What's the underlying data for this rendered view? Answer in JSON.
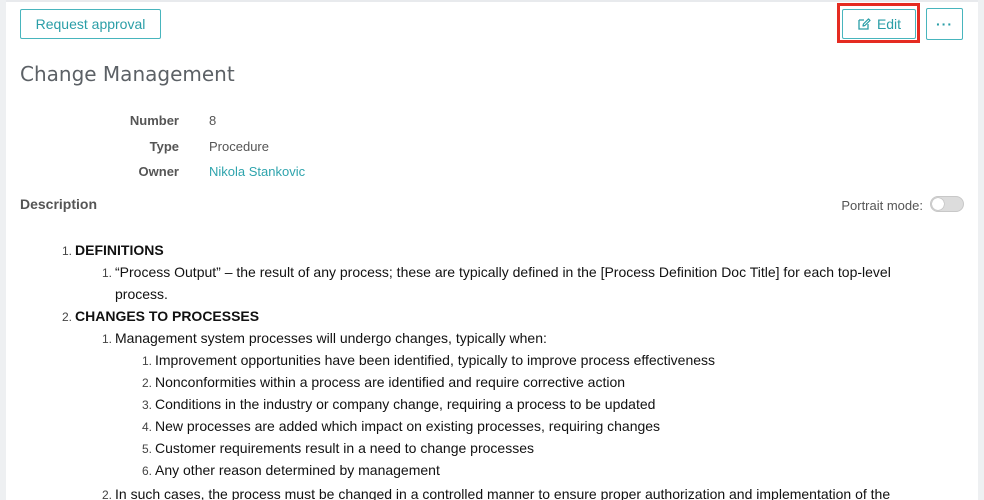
{
  "toolbar": {
    "request_approval_label": "Request approval",
    "edit_label": "Edit",
    "more_label": "···"
  },
  "page": {
    "title": "Change Management"
  },
  "meta": {
    "number": {
      "label": "Number",
      "value": "8"
    },
    "type": {
      "label": "Type",
      "value": "Procedure"
    },
    "owner": {
      "label": "Owner",
      "value": "Nikola Stankovic"
    }
  },
  "description": {
    "label": "Description",
    "portrait_mode_label": "Portrait mode:",
    "portrait_mode_enabled": false
  },
  "doc": {
    "s1": {
      "num": "1.",
      "text": "DEFINITIONS"
    },
    "s1_1": {
      "num": "1.",
      "line1": "“Process Output” – the result of any process; these are typically defined in the [Process Definition Doc Title] for each top-level",
      "line2": "process."
    },
    "s2": {
      "num": "2.",
      "text": "CHANGES TO PROCESSES"
    },
    "s2_1": {
      "num": "1.",
      "text": "Management system processes will undergo changes, typically when:"
    },
    "s2_1_items": [
      {
        "num": "1.",
        "text": "Improvement opportunities have been identified, typically to improve process effectiveness"
      },
      {
        "num": "2.",
        "text": "Nonconformities within a process are identified and require corrective action"
      },
      {
        "num": "3.",
        "text": "Conditions in the industry or company change, requiring a process to be updated"
      },
      {
        "num": "4.",
        "text": "New processes are added which impact on existing processes, requiring changes"
      },
      {
        "num": "5.",
        "text": "Customer requirements result in a need to change processes"
      },
      {
        "num": "6.",
        "text": "Any other reason determined by management"
      }
    ],
    "s2_2": {
      "num": "2.",
      "text": "In such cases, the process must be changed in a controlled manner to ensure proper authorization and implementation of the"
    }
  },
  "colors": {
    "accent": "#2a9ea7",
    "highlight": "#e52b21",
    "link": "#2fa4ad"
  },
  "icons": {
    "edit": "edit-icon"
  }
}
